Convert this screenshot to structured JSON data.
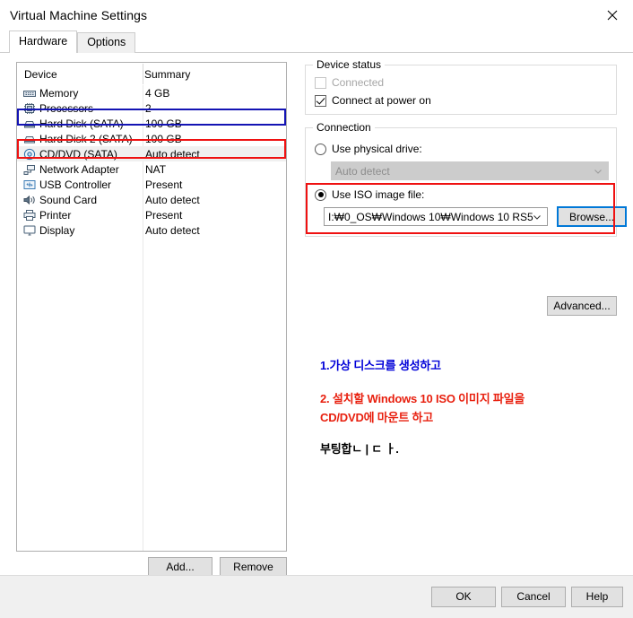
{
  "window": {
    "title": "Virtual Machine Settings",
    "close_icon": "close-icon"
  },
  "tabs": [
    {
      "label": "Hardware",
      "active": true
    },
    {
      "label": "Options",
      "active": false
    }
  ],
  "device_list": {
    "columns": [
      "Device",
      "Summary"
    ],
    "rows": [
      {
        "icon": "memory-icon",
        "name": "Memory",
        "summary": "4 GB"
      },
      {
        "icon": "processor-icon",
        "name": "Processors",
        "summary": "2"
      },
      {
        "icon": "hard-disk-icon",
        "name": "Hard Disk (SATA)",
        "summary": "100 GB"
      },
      {
        "icon": "hard-disk-icon",
        "name": "Hard Disk 2 (SATA)",
        "summary": "100 GB"
      },
      {
        "icon": "cd-dvd-icon",
        "name": "CD/DVD (SATA)",
        "summary": "Auto detect"
      },
      {
        "icon": "network-adapter-icon",
        "name": "Network Adapter",
        "summary": "NAT"
      },
      {
        "icon": "usb-controller-icon",
        "name": "USB Controller",
        "summary": "Present"
      },
      {
        "icon": "sound-card-icon",
        "name": "Sound Card",
        "summary": "Auto detect"
      },
      {
        "icon": "printer-icon",
        "name": "Printer",
        "summary": "Present"
      },
      {
        "icon": "display-icon",
        "name": "Display",
        "summary": "Auto detect"
      }
    ],
    "selected_index": 4,
    "add_label": "Add...",
    "remove_label": "Remove"
  },
  "highlights": {
    "hard_disk_box_color": "#1414b4",
    "cd_dvd_box_color": "#ef1111",
    "iso_box_color": "#ef1111",
    "browse_focus_color": "#0078d7"
  },
  "device_status": {
    "title": "Device status",
    "connected_label": "Connected",
    "connected_checked": false,
    "connected_enabled": false,
    "power_on_label": "Connect at power on",
    "power_on_checked": true
  },
  "connection": {
    "title": "Connection",
    "physical_label": "Use physical drive:",
    "physical_selected": false,
    "physical_value": "Auto detect",
    "physical_enabled": false,
    "iso_label": "Use ISO image file:",
    "iso_selected": true,
    "iso_value": "I:₩0_OS₩Windows 10₩Windows 10 RS5",
    "browse_label": "Browse..."
  },
  "advanced_label": "Advanced...",
  "annotations": {
    "line1": "1.가상 디스크를 생성하고",
    "line2": "2. 설치할 Windows 10 ISO 이미지 파일을",
    "line3": "CD/DVD에 마운트 하고",
    "line4": "부팅합ㄴ | ㄷ ㅏ.",
    "color_blue": "#0000d8",
    "color_red": "#e8200f",
    "color_black": "#000000"
  },
  "footer": {
    "ok_label": "OK",
    "cancel_label": "Cancel",
    "help_label": "Help"
  }
}
